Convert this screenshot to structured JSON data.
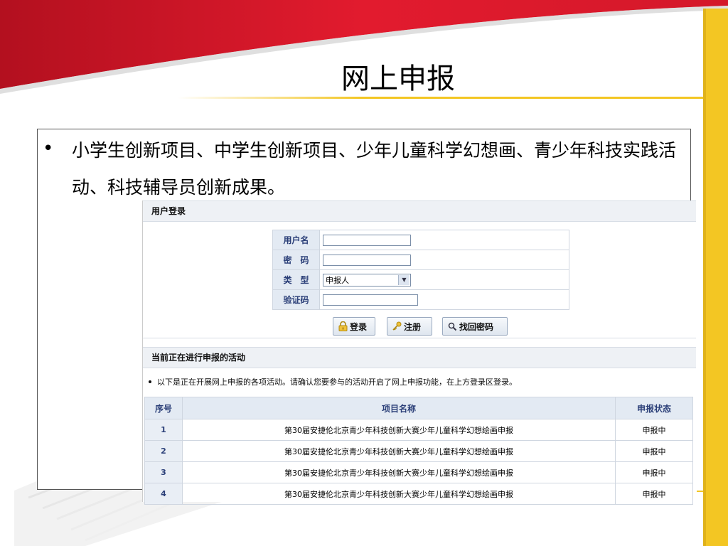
{
  "slide": {
    "title": "网上申报",
    "bullet_symbol": "•",
    "bullet_text": "小学生创新项目、中学生创新项目、少年儿童科学幻想画、青少年科技实践活动、科技辅导员创新成果。"
  },
  "login_panel": {
    "header": "用户登录",
    "username_label": "用户名",
    "password_label": "密　码",
    "type_label": "类　型",
    "type_selected": "申报人",
    "captcha_label": "验证码",
    "username_value": "",
    "password_value": "",
    "captcha_value": "",
    "buttons": {
      "login": "登录",
      "register": "注册",
      "recover": "找回密码"
    }
  },
  "activities_panel": {
    "header": "当前正在进行申报的活动",
    "notice": "以下是正在开展网上申报的各项活动。请确认您要参与的活动开启了网上申报功能，在上方登录区登录。",
    "columns": [
      "序号",
      "项目名称",
      "申报状态"
    ],
    "rows": [
      {
        "no": "1",
        "name": "第30届安捷伦北京青少年科技创新大赛少年儿童科学幻想绘画申报",
        "status": "申报中"
      },
      {
        "no": "2",
        "name": "第30届安捷伦北京青少年科技创新大赛少年儿童科学幻想绘画申报",
        "status": "申报中"
      },
      {
        "no": "3",
        "name": "第30届安捷伦北京青少年科技创新大赛少年儿童科学幻想绘画申报",
        "status": "申报中"
      },
      {
        "no": "4",
        "name": "第30届安捷伦北京青少年科技创新大赛少年儿童科学幻想绘画申报",
        "status": "申报中"
      }
    ]
  },
  "colors": {
    "red_band": "#d8192b",
    "yellow_bar": "#f3c623",
    "table_header_bg": "#e3eaf3",
    "label_text": "#2b3f78"
  }
}
